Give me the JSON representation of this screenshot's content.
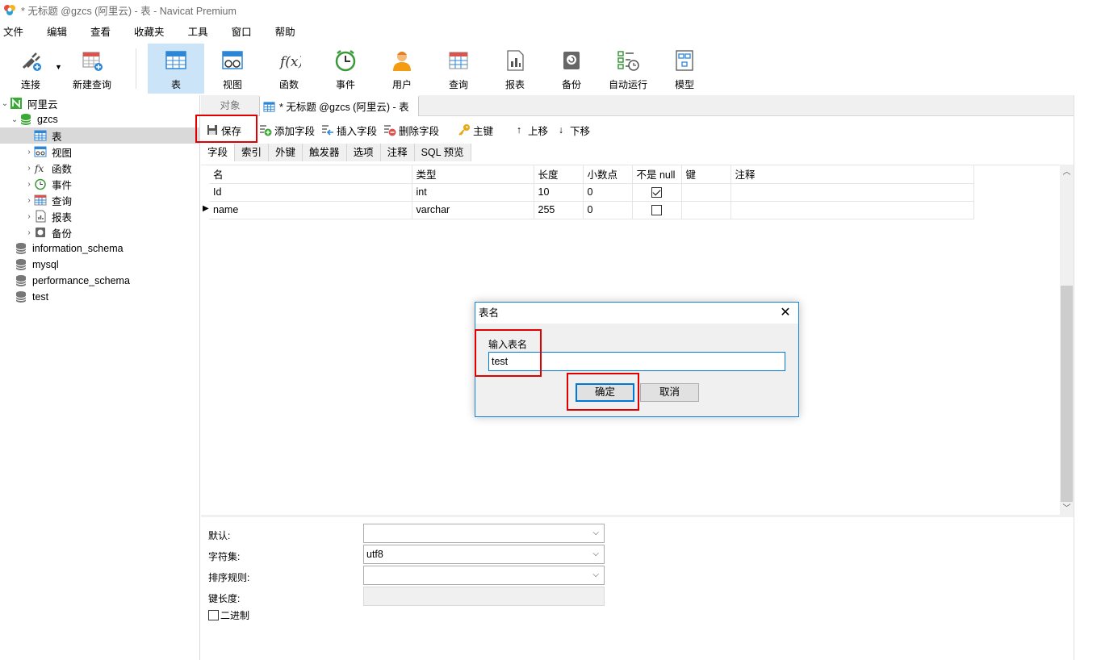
{
  "window": {
    "title": "* 无标题 @gzcs (阿里云) - 表 - Navicat Premium"
  },
  "menu": [
    "文件",
    "编辑",
    "查看",
    "收藏夹",
    "工具",
    "窗口",
    "帮助"
  ],
  "toolbar": {
    "connect": "连接",
    "new_query": "新建查询",
    "table": "表",
    "view": "视图",
    "function": "函数",
    "event": "事件",
    "user": "用户",
    "query": "查询",
    "report": "报表",
    "backup": "备份",
    "auto_run": "自动运行",
    "model": "模型"
  },
  "tree": {
    "connection": "阿里云",
    "database": "gzcs",
    "items": [
      "表",
      "视图",
      "函数",
      "事件",
      "查询",
      "报表",
      "备份"
    ],
    "other_dbs": [
      "information_schema",
      "mysql",
      "performance_schema",
      "test"
    ]
  },
  "tabs": {
    "objects": "对象",
    "current": "* 无标题 @gzcs (阿里云) - 表"
  },
  "edit_toolbar": {
    "save": "保存",
    "add_field": "添加字段",
    "insert_field": "插入字段",
    "delete_field": "删除字段",
    "primary_key": "主键",
    "move_up": "上移",
    "move_down": "下移"
  },
  "subtabs": [
    "字段",
    "索引",
    "外键",
    "触发器",
    "选项",
    "注释",
    "SQL 预览"
  ],
  "grid": {
    "headers": [
      "名",
      "类型",
      "长度",
      "小数点",
      "不是 null",
      "键",
      "注释"
    ],
    "rows": [
      {
        "name": "Id",
        "type": "int",
        "length": "10",
        "decimals": "0",
        "not_null": true
      },
      {
        "name": "name",
        "type": "varchar",
        "length": "255",
        "decimals": "0",
        "not_null": false
      }
    ]
  },
  "props": {
    "default_label": "默认:",
    "charset_label": "字符集:",
    "charset_value": "utf8",
    "collation_label": "排序规则:",
    "key_length_label": "键长度:",
    "binary_label": "二进制"
  },
  "dialog": {
    "title": "表名",
    "prompt": "输入表名",
    "value": "test",
    "ok": "确定",
    "cancel": "取消"
  }
}
